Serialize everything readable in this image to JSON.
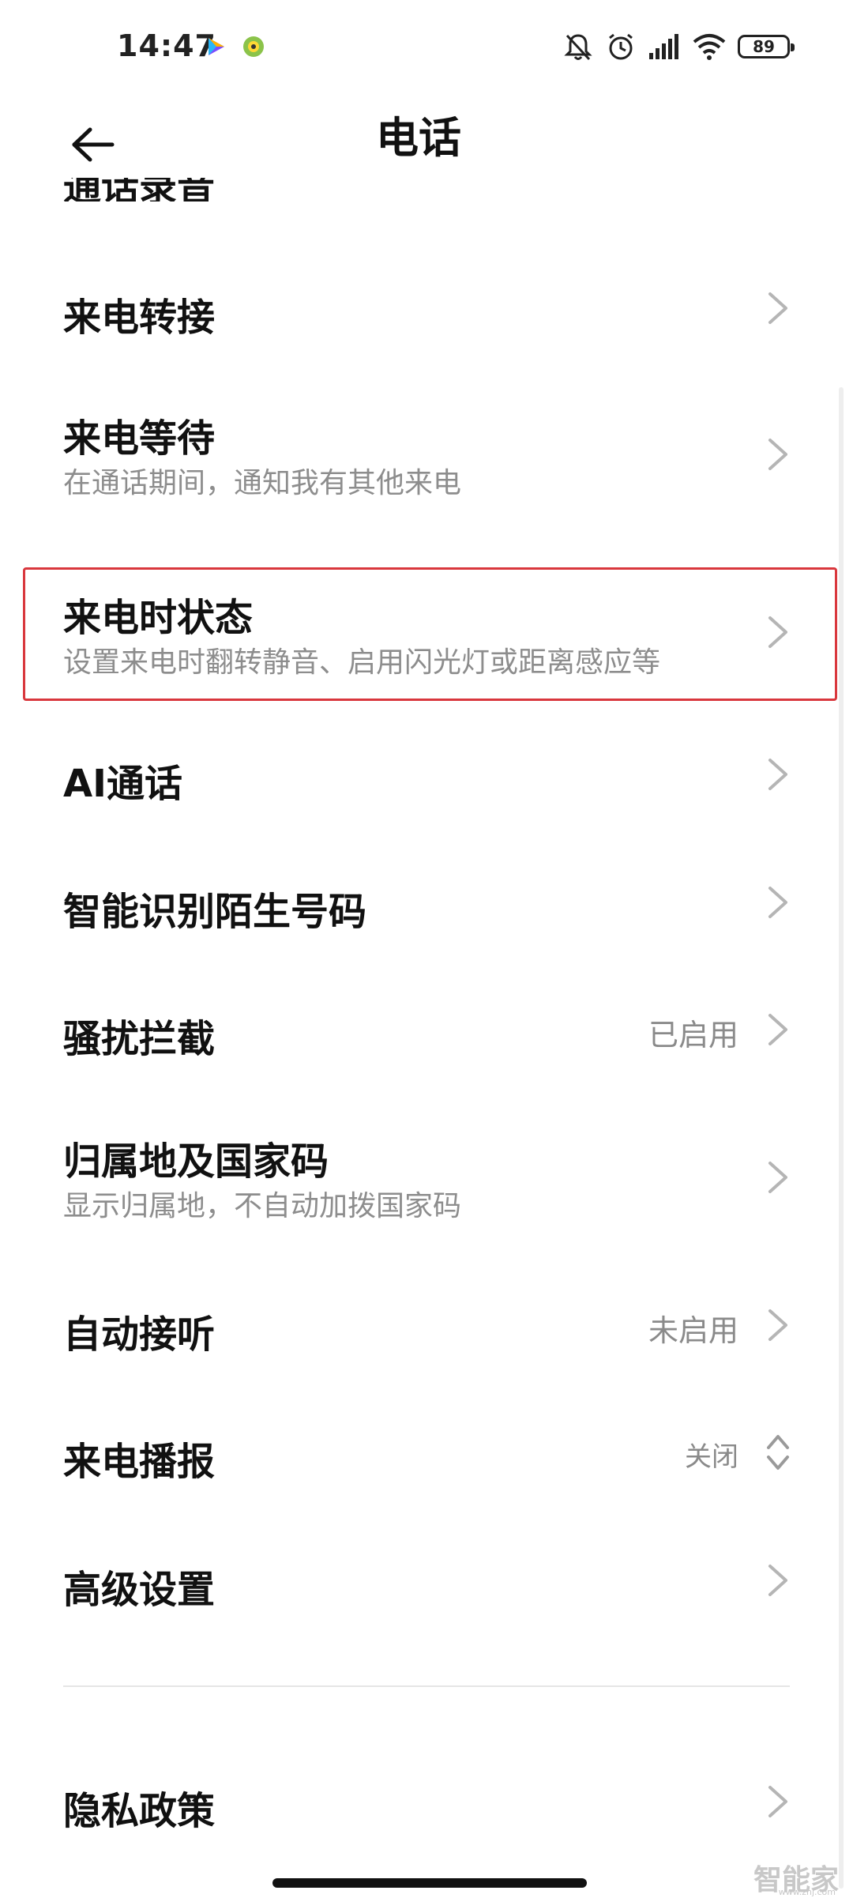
{
  "status_bar": {
    "time": "14:47",
    "battery": "89",
    "icons": [
      "play-store-icon",
      "music-app-icon",
      "silent-bell-icon",
      "alarm-icon",
      "signal-icon",
      "wifi-icon",
      "battery-icon"
    ]
  },
  "header": {
    "title": "电话"
  },
  "settings": [
    {
      "title": "通话录音",
      "value": ""
    },
    {
      "title": "来电转接",
      "subtitle": "",
      "value": ""
    },
    {
      "title": "来电等待",
      "subtitle": "在通话期间，通知我有其他来电",
      "value": ""
    },
    {
      "title": "来电时状态",
      "subtitle": "设置来电时翻转静音、启用闪光灯或距离感应等",
      "value": ""
    },
    {
      "title": "AI通话",
      "subtitle": "",
      "value": ""
    },
    {
      "title": "智能识别陌生号码",
      "subtitle": "",
      "value": ""
    },
    {
      "title": "骚扰拦截",
      "subtitle": "",
      "value": "已启用"
    },
    {
      "title": "归属地及国家码",
      "subtitle": "显示归属地，不自动加拨国家码",
      "value": ""
    },
    {
      "title": "自动接听",
      "subtitle": "",
      "value": "未启用"
    },
    {
      "title": "来电播报",
      "subtitle": "",
      "value": "关闭"
    },
    {
      "title": "高级设置",
      "subtitle": "",
      "value": ""
    },
    {
      "title": "隐私政策",
      "subtitle": "",
      "value": ""
    }
  ],
  "watermark": {
    "text": "智能家",
    "url": "www.znj.com"
  },
  "colors": {
    "highlight": "#d9373d",
    "secondary_text": "#8d8d8d",
    "chevron": "#b5b5b5"
  }
}
